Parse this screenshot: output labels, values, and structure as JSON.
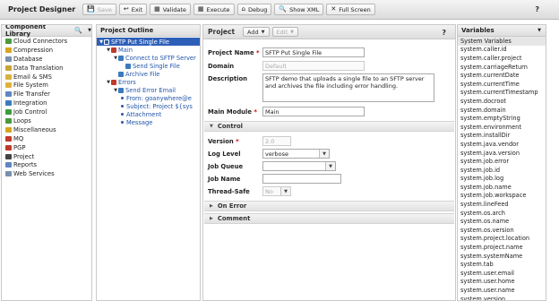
{
  "app": {
    "title": "Project Designer",
    "help": "?"
  },
  "toolbar": [
    {
      "name": "save-button",
      "icon": "save-icon",
      "glyph": "💾",
      "label": "Save",
      "disabled": true
    },
    {
      "name": "exit-button",
      "icon": "exit-icon",
      "glyph": "↩",
      "label": "Exit",
      "disabled": false
    },
    {
      "name": "validate-button",
      "icon": "validate-icon",
      "glyph": "▦",
      "label": "Validate",
      "disabled": false
    },
    {
      "name": "execute-button",
      "icon": "execute-icon",
      "glyph": "▦",
      "label": "Execute",
      "disabled": false
    },
    {
      "name": "debug-button",
      "icon": "debug-icon",
      "glyph": "⌂",
      "label": "Debug",
      "disabled": false
    },
    {
      "name": "show-xml-button",
      "icon": "xml-icon",
      "glyph": "🔍",
      "label": "Show XML",
      "disabled": false
    },
    {
      "name": "full-screen-button",
      "icon": "fullscreen-icon",
      "glyph": "✕",
      "label": "Full Screen",
      "disabled": false
    }
  ],
  "library": {
    "title": "Component Library",
    "items": [
      {
        "label": "Cloud Connectors",
        "color": "#4a9a3c"
      },
      {
        "label": "Compression",
        "color": "#d9a520"
      },
      {
        "label": "Database",
        "color": "#7a8fb0"
      },
      {
        "label": "Data Translation",
        "color": "#c7a43a"
      },
      {
        "label": "Email & SMS",
        "color": "#d7b13c"
      },
      {
        "label": "File System",
        "color": "#e0b23c"
      },
      {
        "label": "File Transfer",
        "color": "#5f86c2"
      },
      {
        "label": "Integration",
        "color": "#3b7bbd"
      },
      {
        "label": "Job Control",
        "color": "#3d9c3d"
      },
      {
        "label": "Loops",
        "color": "#4a9a3c"
      },
      {
        "label": "Miscellaneous",
        "color": "#d9a520"
      },
      {
        "label": "MQ",
        "color": "#c0392b"
      },
      {
        "label": "PGP",
        "color": "#c0392b"
      },
      {
        "label": "Project",
        "color": "#444444"
      },
      {
        "label": "Reports",
        "color": "#5f86c2"
      },
      {
        "label": "Web Services",
        "color": "#7a8fb0"
      }
    ]
  },
  "outline": {
    "title": "Project Outline",
    "nodes": [
      {
        "label": "SFTP Put Single File",
        "indent": 0,
        "kind": "project",
        "expanded": true,
        "selected": true
      },
      {
        "label": "Main",
        "indent": 1,
        "kind": "module",
        "expanded": true
      },
      {
        "label": "Connect to SFTP Server",
        "indent": 2,
        "kind": "task",
        "expanded": true
      },
      {
        "label": "Send Single File",
        "indent": 3,
        "kind": "task"
      },
      {
        "label": "Archive File",
        "indent": 2,
        "kind": "task"
      },
      {
        "label": "Errors",
        "indent": 1,
        "kind": "module",
        "expanded": true
      },
      {
        "label": "Send Error Email",
        "indent": 2,
        "kind": "task",
        "expanded": true
      },
      {
        "label": "From: goanywhere@e",
        "indent": 3,
        "kind": "bullet"
      },
      {
        "label": "Subject: Project ${sys",
        "indent": 3,
        "kind": "bullet"
      },
      {
        "label": "Attachment",
        "indent": 3,
        "kind": "bullet"
      },
      {
        "label": "Message",
        "indent": 3,
        "kind": "bullet"
      }
    ]
  },
  "editor": {
    "title": "Project",
    "add": "Add",
    "edit": "Edit",
    "help": "?",
    "project_name_label": "Project Name",
    "project_name": "SFTP Put Single File",
    "domain_label": "Domain",
    "domain": "Default",
    "description_label": "Description",
    "description": "SFTP demo that uploads a single file to an SFTP server and archives the file including error handling.",
    "main_module_label": "Main Module",
    "main_module": "Main",
    "control_section": "Control",
    "version_label": "Version",
    "version": "2.0",
    "log_level_label": "Log Level",
    "log_level": "verbose",
    "job_queue_label": "Job Queue",
    "job_queue": "",
    "job_name_label": "Job Name",
    "job_name": "",
    "thread_safe_label": "Thread-Safe",
    "thread_safe": "No",
    "on_error_section": "On Error",
    "comment_section": "Comment"
  },
  "variables": {
    "title": "Variables",
    "items": [
      "System Variables",
      "system.caller.id",
      "system.caller.project",
      "system.carriageReturn",
      "system.currentDate",
      "system.currentTime",
      "system.currentTimestamp",
      "system.docroot",
      "system.domain",
      "system.emptyString",
      "system.environment",
      "system.installDir",
      "system.java.vendor",
      "system.java.version",
      "system.job.error",
      "system.job.id",
      "system.job.log",
      "system.job.name",
      "system.job.workspace",
      "system.lineFeed",
      "system.os.arch",
      "system.os.name",
      "system.os.version",
      "system.project.location",
      "system.project.name",
      "system.systemName",
      "system.tab",
      "system.user.email",
      "system.user.home",
      "system.user.name",
      "system.version"
    ]
  }
}
